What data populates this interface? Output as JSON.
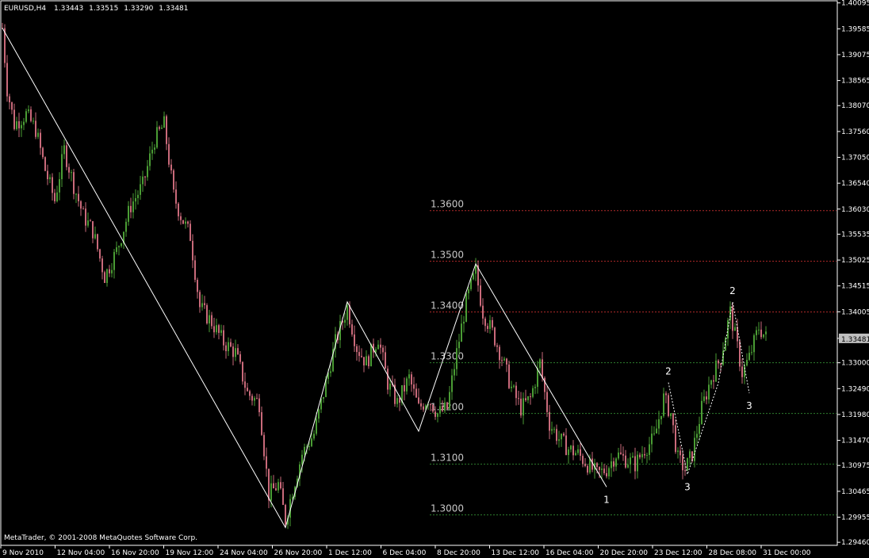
{
  "header": {
    "symbol": "EURUSD,H4",
    "open": "1.33443",
    "high": "1.33515",
    "low": "1.33290",
    "close": "1.33481"
  },
  "footer": {
    "copyright": "MetaTrader, © 2001-2008 MetaQuotes Software Corp."
  },
  "colors": {
    "background": "#000000",
    "frame": "#ffffff",
    "bull": "#4a9c34",
    "bear": "#c96a7a",
    "resistance_level": "#b02a2a",
    "support_level": "#2e7d2e",
    "level_label": "#c8c8c8",
    "current_price_box": "#c0c0c0",
    "wave_line": "#ffffff"
  },
  "chart_data": {
    "type": "candlestick",
    "title": "EURUSD,H4",
    "ylim": [
      1.294,
      1.4009
    ],
    "y_ticks": [
      "1.40095",
      "1.39585",
      "1.39075",
      "1.38565",
      "1.38070",
      "1.37560",
      "1.37050",
      "1.36540",
      "1.36030",
      "1.35535",
      "1.35025",
      "1.34515",
      "1.34005",
      "1.33481",
      "1.33000",
      "1.32490",
      "1.31980",
      "1.31470",
      "1.30975",
      "1.30465",
      "1.29955",
      "1.29460"
    ],
    "x_ticks": [
      "9 Nov 2010",
      "12 Nov 04:00",
      "16 Nov 20:00",
      "19 Nov 12:00",
      "24 Nov 04:00",
      "26 Nov 20:00",
      "1 Dec 12:00",
      "6 Dec 04:00",
      "8 Dec 20:00",
      "13 Dec 12:00",
      "16 Dec 04:00",
      "20 Dec 20:00",
      "23 Dec 12:00",
      "28 Dec 08:00",
      "31 Dec 00:00"
    ],
    "current_price": "1.33481",
    "price_path": [
      [
        0,
        1.396
      ],
      [
        2,
        1.384
      ],
      [
        5,
        1.377
      ],
      [
        10,
        1.379
      ],
      [
        14,
        1.376
      ],
      [
        18,
        1.368
      ],
      [
        22,
        1.362
      ],
      [
        26,
        1.372
      ],
      [
        30,
        1.365
      ],
      [
        34,
        1.359
      ],
      [
        38,
        1.356
      ],
      [
        43,
        1.347
      ],
      [
        48,
        1.352
      ],
      [
        54,
        1.361
      ],
      [
        59,
        1.365
      ],
      [
        64,
        1.374
      ],
      [
        68,
        1.377
      ],
      [
        72,
        1.363
      ],
      [
        75,
        1.359
      ],
      [
        79,
        1.355
      ],
      [
        83,
        1.341
      ],
      [
        88,
        1.338
      ],
      [
        93,
        1.334
      ],
      [
        98,
        1.332
      ],
      [
        103,
        1.324
      ],
      [
        108,
        1.322
      ],
      [
        112,
        1.304
      ],
      [
        116,
        1.306
      ],
      [
        119,
        1.299
      ],
      [
        122,
        1.305
      ],
      [
        126,
        1.312
      ],
      [
        131,
        1.316
      ],
      [
        136,
        1.326
      ],
      [
        140,
        1.334
      ],
      [
        145,
        1.341
      ],
      [
        149,
        1.333
      ],
      [
        153,
        1.33
      ],
      [
        158,
        1.335
      ],
      [
        162,
        1.326
      ],
      [
        166,
        1.322
      ],
      [
        171,
        1.327
      ],
      [
        175,
        1.321
      ],
      [
        179,
        1.323
      ],
      [
        183,
        1.32
      ],
      [
        187,
        1.321
      ],
      [
        191,
        1.332
      ],
      [
        195,
        1.342
      ],
      [
        199,
        1.348
      ],
      [
        202,
        1.34
      ],
      [
        206,
        1.336
      ],
      [
        210,
        1.331
      ],
      [
        214,
        1.325
      ],
      [
        218,
        1.321
      ],
      [
        222,
        1.323
      ],
      [
        226,
        1.33
      ],
      [
        230,
        1.318
      ],
      [
        234,
        1.315
      ],
      [
        238,
        1.313
      ],
      [
        242,
        1.312
      ],
      [
        246,
        1.31
      ],
      [
        250,
        1.308
      ],
      [
        254,
        1.309
      ],
      [
        258,
        1.312
      ],
      [
        262,
        1.311
      ],
      [
        266,
        1.31
      ],
      [
        270,
        1.313
      ],
      [
        274,
        1.315
      ],
      [
        278,
        1.323
      ],
      [
        281,
        1.32
      ],
      [
        284,
        1.311
      ],
      [
        287,
        1.309
      ],
      [
        290,
        1.312
      ],
      [
        294,
        1.321
      ],
      [
        298,
        1.327
      ],
      [
        302,
        1.331
      ],
      [
        306,
        1.34
      ],
      [
        309,
        1.333
      ],
      [
        311,
        1.328
      ],
      [
        314,
        1.331
      ],
      [
        318,
        1.337
      ],
      [
        321,
        1.335
      ]
    ],
    "levels": [
      {
        "label": "1.3600",
        "value": 1.36,
        "kind": "resistance"
      },
      {
        "label": "1.3500",
        "value": 1.35,
        "kind": "resistance"
      },
      {
        "label": "1.3400",
        "value": 1.34,
        "kind": "resistance"
      },
      {
        "label": "1.3300",
        "value": 1.33,
        "kind": "support"
      },
      {
        "label": "1.3200",
        "value": 1.32,
        "kind": "support"
      },
      {
        "label": "1.3100",
        "value": 1.31,
        "kind": "support"
      },
      {
        "label": "1.3000",
        "value": 1.3,
        "kind": "support"
      }
    ],
    "zigzag": [
      [
        0,
        1.396
      ],
      [
        119,
        1.2975
      ],
      [
        145,
        1.342
      ],
      [
        175,
        1.3165
      ],
      [
        199,
        1.3495
      ],
      [
        254,
        1.3055
      ]
    ],
    "wave_path": [
      [
        280,
        1.3261
      ],
      [
        288,
        1.308
      ],
      [
        301,
        1.326
      ],
      [
        307,
        1.342
      ],
      [
        314,
        1.324
      ]
    ],
    "wave_labels": [
      {
        "text": "1",
        "x": 254,
        "y": 1.3055
      },
      {
        "text": "2",
        "x": 280,
        "y": 1.3261
      },
      {
        "text": "3",
        "x": 288,
        "y": 1.308
      },
      {
        "text": "2",
        "x": 307,
        "y": 1.342
      },
      {
        "text": "3",
        "x": 314,
        "y": 1.324
      }
    ]
  }
}
